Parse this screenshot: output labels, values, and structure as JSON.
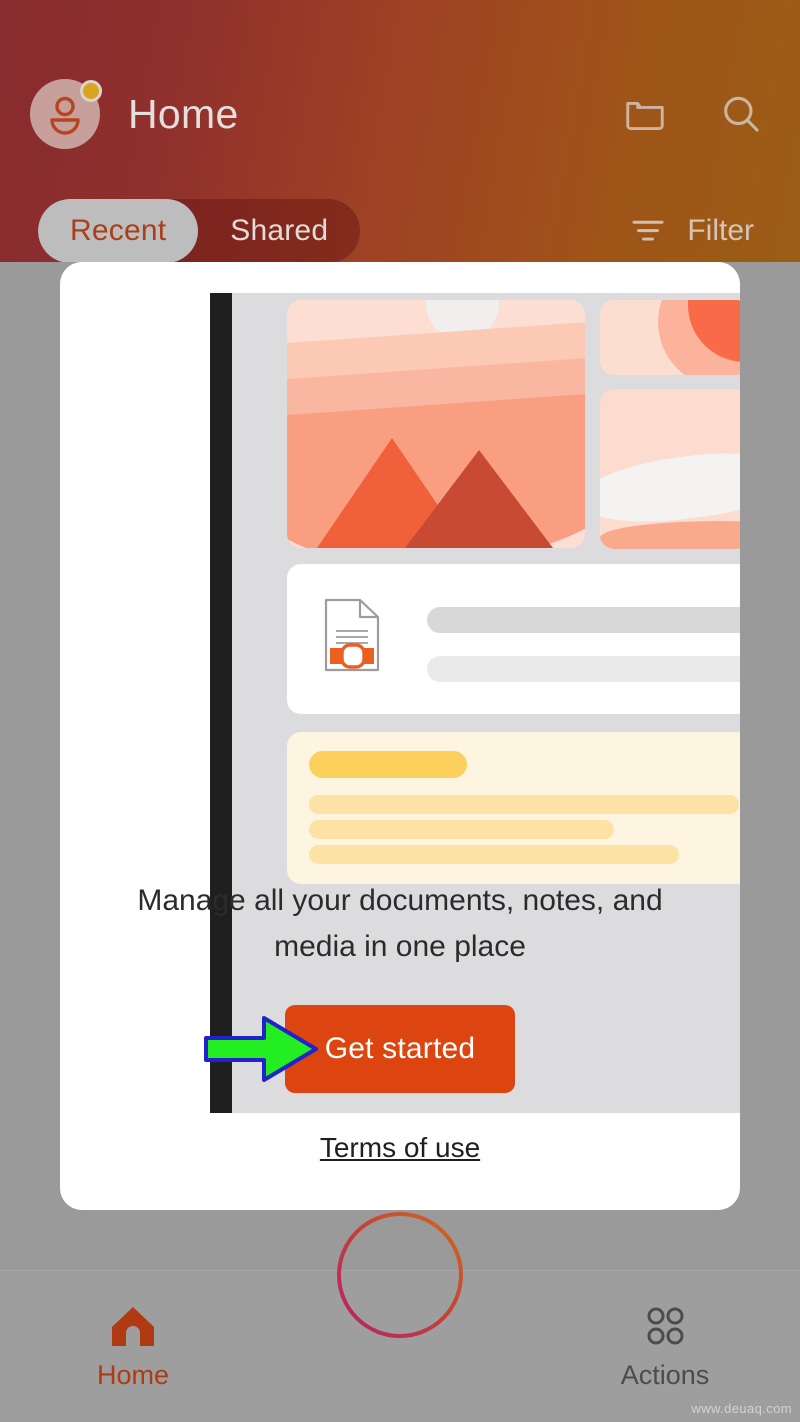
{
  "header": {
    "title": "Home",
    "avatar": {
      "icon": "person-avatar-icon",
      "badge": "status-badge-dot"
    },
    "actions": [
      {
        "name": "folder-icon",
        "label": "Folder"
      },
      {
        "name": "search-icon",
        "label": "Search"
      }
    ],
    "tabs": [
      {
        "label": "Recent",
        "active": true
      },
      {
        "label": "Shared",
        "active": false
      }
    ],
    "filter": {
      "label": "Filter",
      "icon": "filter-icon"
    },
    "colors": {
      "gradient_start": "#8d1f23",
      "gradient_end": "#a35a05",
      "active_tab_text": "#a8401c"
    }
  },
  "modal": {
    "illustration": {
      "name": "documents-notes-media-illustration",
      "tiles": [
        "hero-landscape-tile",
        "small-image-tile-top",
        "small-image-tile-bottom"
      ],
      "doc_icon": "pdf-document-icon",
      "note_card": "yellow-note-card"
    },
    "headline": "Manage all your documents, notes, and media in one place",
    "cta_label": "Get started",
    "terms_label": "Terms of use",
    "colors": {
      "cta_bg": "#dd4510",
      "cta_text": "#ffffff",
      "note_yellow": "#fbd05c",
      "accent_coral": "#f0603b"
    }
  },
  "annotation": {
    "name": "green-arrow-pointer",
    "fill": "#22ee22",
    "stroke": "#2222cc"
  },
  "bottom_nav": {
    "items": [
      {
        "label": "Home",
        "icon": "home-icon",
        "active": true
      },
      {
        "label": "Actions",
        "icon": "grid-dots-icon",
        "active": false
      }
    ],
    "fab": {
      "icon": "plus-icon",
      "gradient_start": "#d2691e",
      "gradient_end": "#b5216b"
    }
  },
  "watermark": "www.deuaq.com"
}
